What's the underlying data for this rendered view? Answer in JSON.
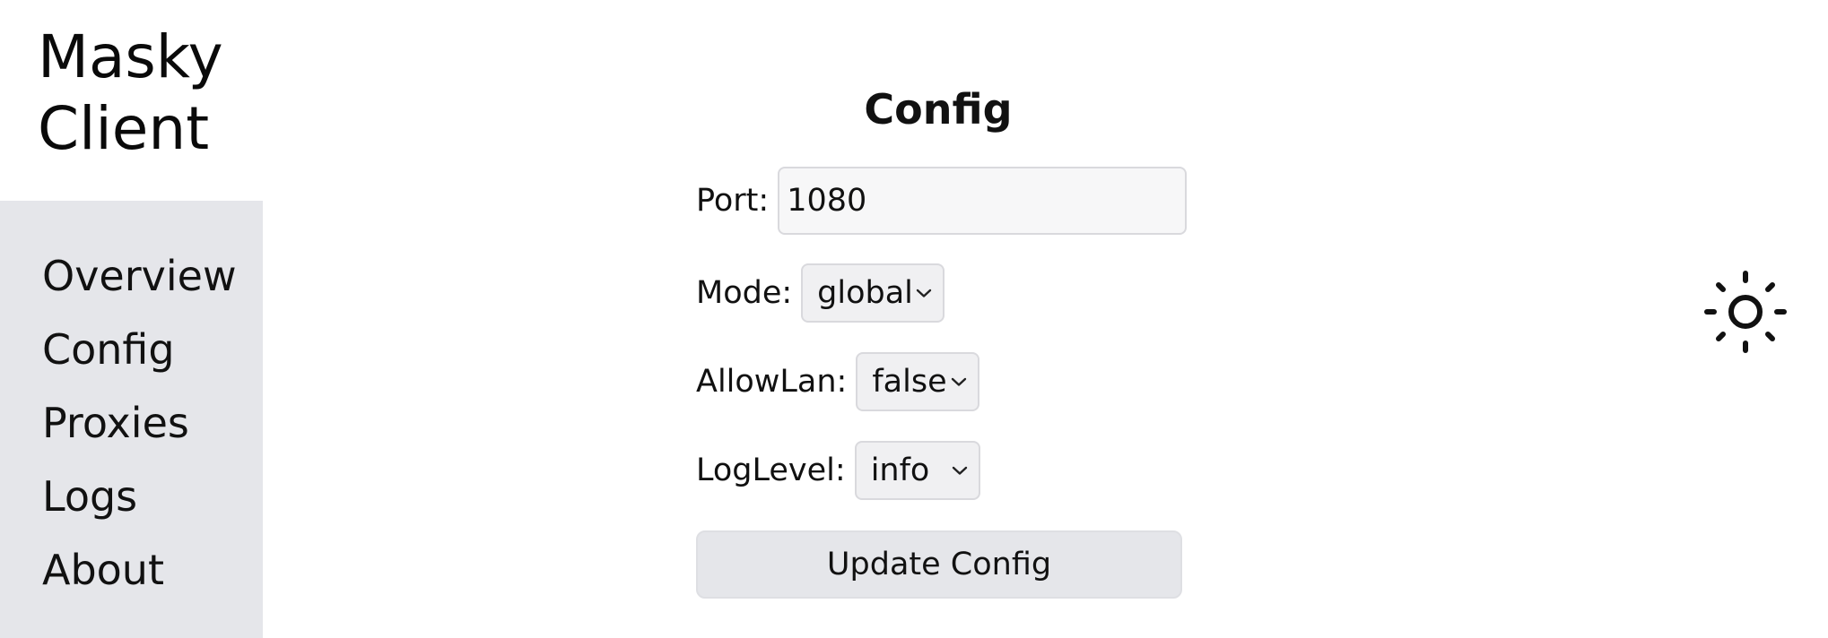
{
  "app": {
    "title_line1": "Masky",
    "title_line2": "Client"
  },
  "sidebar": {
    "items": [
      {
        "label": "Overview"
      },
      {
        "label": "Config"
      },
      {
        "label": "Proxies"
      },
      {
        "label": "Logs"
      },
      {
        "label": "About"
      }
    ]
  },
  "main": {
    "title": "Config",
    "port": {
      "label": "Port:",
      "value": "1080"
    },
    "mode": {
      "label": "Mode:",
      "value": "global"
    },
    "allow_lan": {
      "label": "AllowLan:",
      "value": "false"
    },
    "log_level": {
      "label": "LogLevel:",
      "value": "info"
    },
    "update_button_label": "Update Config"
  },
  "theme_toggle": {
    "icon": "sun-icon"
  }
}
